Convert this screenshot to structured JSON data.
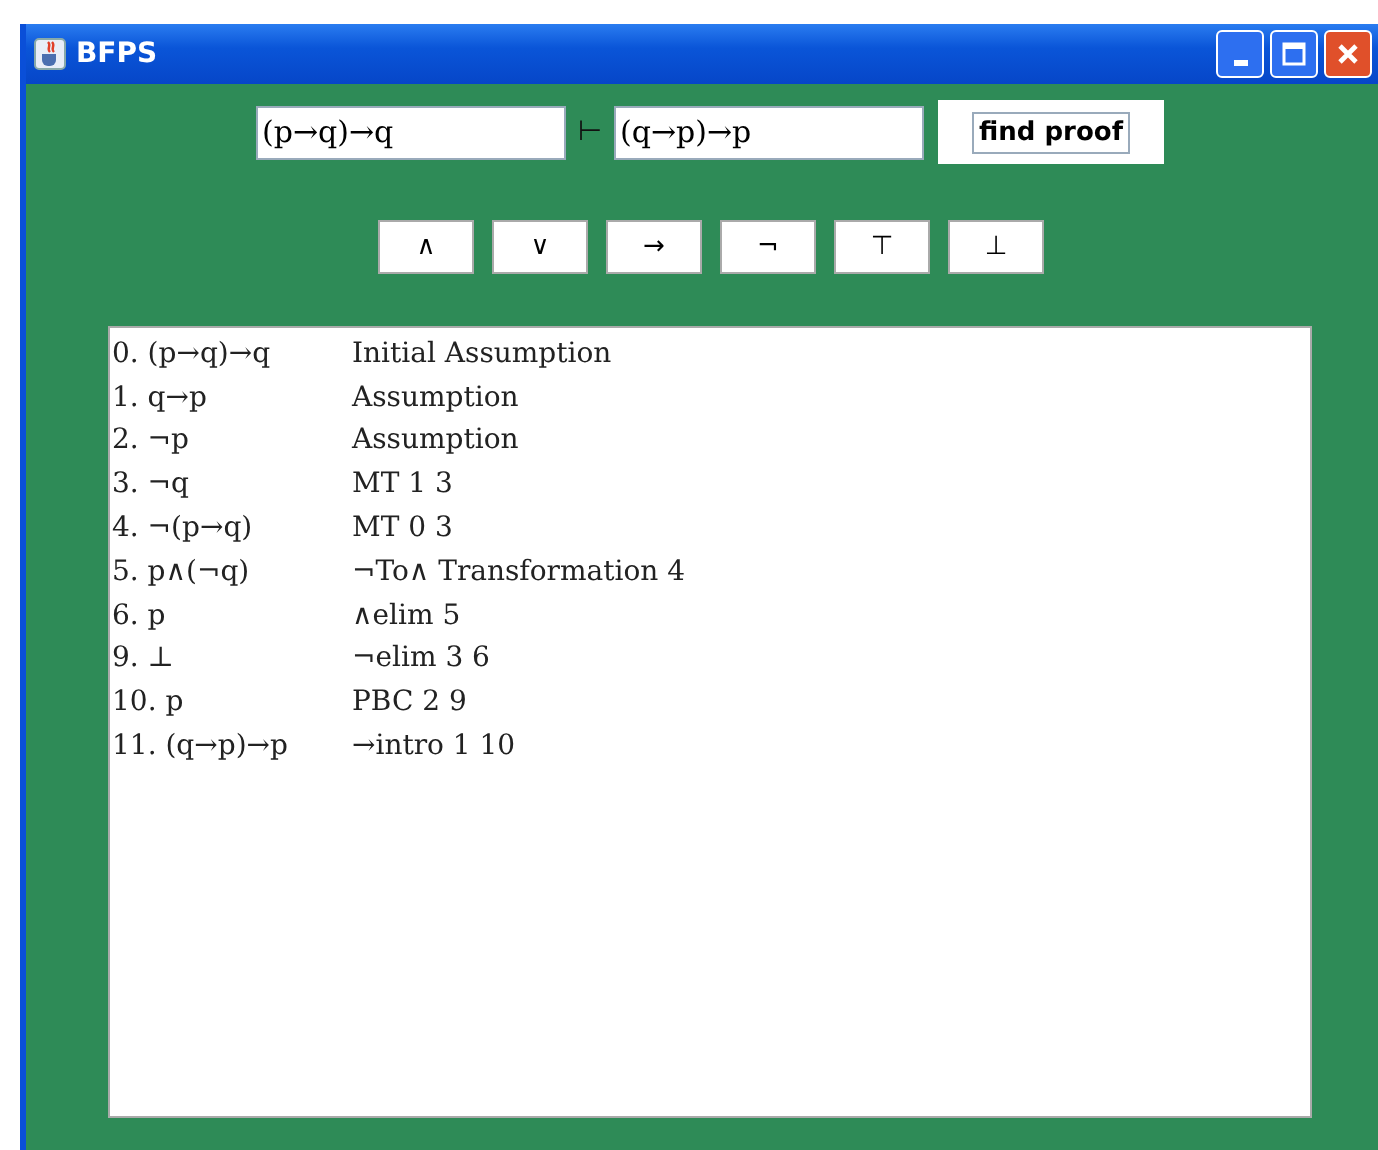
{
  "window": {
    "title": "BFPS"
  },
  "premise": {
    "value": "(p→q)→q"
  },
  "turnstile": "⊢",
  "goal": {
    "value": "(q→p)→p"
  },
  "find_button": "find proof",
  "symbol_buttons": [
    "∧",
    "∨",
    "→",
    "¬",
    "⊤",
    "⊥"
  ],
  "proof_lines": [
    {
      "formula": "0.  (p→q)→q",
      "justification": "Initial Assumption"
    },
    {
      "formula": "1.  q→p",
      "justification": "Assumption"
    },
    {
      "formula": "2.  ¬p",
      "justification": "Assumption"
    },
    {
      "formula": "3.  ¬q",
      "justification": "MT 1 3"
    },
    {
      "formula": "4.  ¬(p→q)",
      "justification": "MT 0 3"
    },
    {
      "formula": "5.  p∧(¬q)",
      "justification": "¬To∧ Transformation 4"
    },
    {
      "formula": "6.  p",
      "justification": "∧elim 5"
    },
    {
      "formula": "9.  ⊥",
      "justification": "¬elim 3 6"
    },
    {
      "formula": "10.  p",
      "justification": "PBC 2 9"
    },
    {
      "formula": "11.  (q→p)→p",
      "justification": "→intro 1 10"
    }
  ]
}
